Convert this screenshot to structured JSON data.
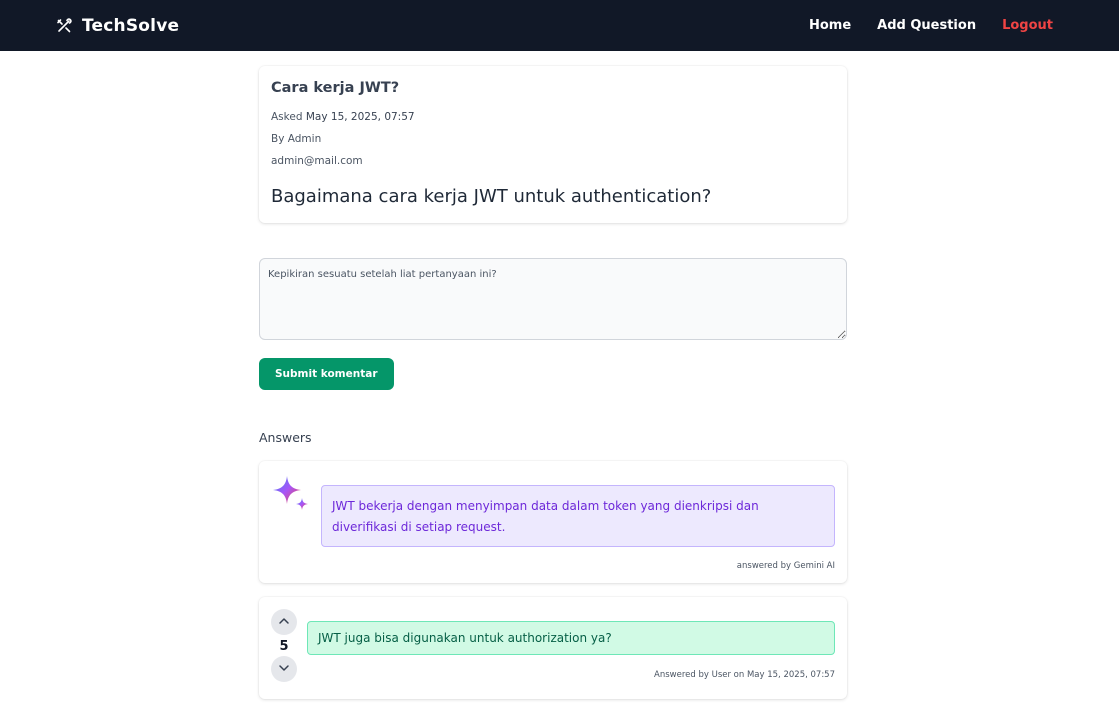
{
  "nav": {
    "brand_icon": "tools-icon",
    "brand": "TechSolve",
    "links": {
      "home": "Home",
      "add_question": "Add Question",
      "logout": "Logout"
    }
  },
  "question": {
    "title": "Cara kerja JWT?",
    "asked_prefix": "Asked",
    "asked_date": "May 15, 2025, 07:57",
    "by": "By Admin",
    "email": "admin@mail.com",
    "body": "Bagaimana cara kerja JWT untuk authentication?"
  },
  "comment": {
    "placeholder": "Kepikiran sesuatu setelah liat pertanyaan ini?",
    "submit_label": "Submit komentar"
  },
  "answers": {
    "heading": "Answers",
    "ai": {
      "icon": "gemini-sparkle-icon",
      "text": "JWT bekerja dengan menyimpan data dalam token yang dienkripsi dan diverifikasi di setiap request.",
      "footer": "answered by Gemini AI"
    },
    "user": {
      "votes": "5",
      "text": "JWT juga bisa digunakan untuk authorization ya?",
      "footer": "Answered by User on May 15, 2025, 07:57"
    }
  },
  "colors": {
    "navbar_bg": "#111827",
    "logout": "#ef4444",
    "submit_bg": "#059669",
    "ai_bubble_bg": "#ede9fe",
    "ai_text": "#6d28d9",
    "user_bubble_bg": "#d1fae5",
    "user_text": "#065f46"
  }
}
